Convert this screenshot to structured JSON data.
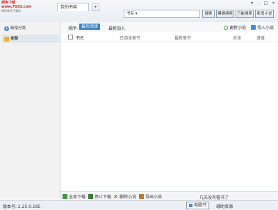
{
  "titlebar": {
    "logo_line1": "绿色下载 www.7G52.com",
    "logo_line2": "绿色软件下载站",
    "tab_label": "我的书架",
    "tab_add": "+",
    "window_buttons": [
      "▾",
      "–",
      "□",
      "×"
    ]
  },
  "search": {
    "field_value": "书名 ▾",
    "buttons": [
      "搜索",
      "模糊搜索",
      "万能搜索",
      "新增小说"
    ]
  },
  "sidebar": {
    "new_category": "新增分类",
    "all_label": "全部"
  },
  "sortbar": {
    "label": "排序:",
    "sort_recent_read": "最后阅读",
    "sort_recent_added": "最新加入",
    "update_novels": "更新小说",
    "import_novels": "导入小说"
  },
  "list_header": {
    "name": "书名",
    "read_chapter": "已阅读章节",
    "latest_chapter": "最新章节",
    "unread": "未读",
    "progress": "进度"
  },
  "bottom_toolbar": {
    "full_download": "全本下载",
    "stop_download": "停止下载",
    "delete_novel": "删除小说",
    "export_novel": "导出小说",
    "message": "几天没有看书了"
  },
  "statusbar": {
    "version": "版本号: 2.25.0.185",
    "ebook_btn": "电脑书",
    "ebook_info": "辅助资源"
  },
  "colors": {
    "accent_blue": "#4a8bd1",
    "sort_active_bg": "#3d7fc8"
  }
}
